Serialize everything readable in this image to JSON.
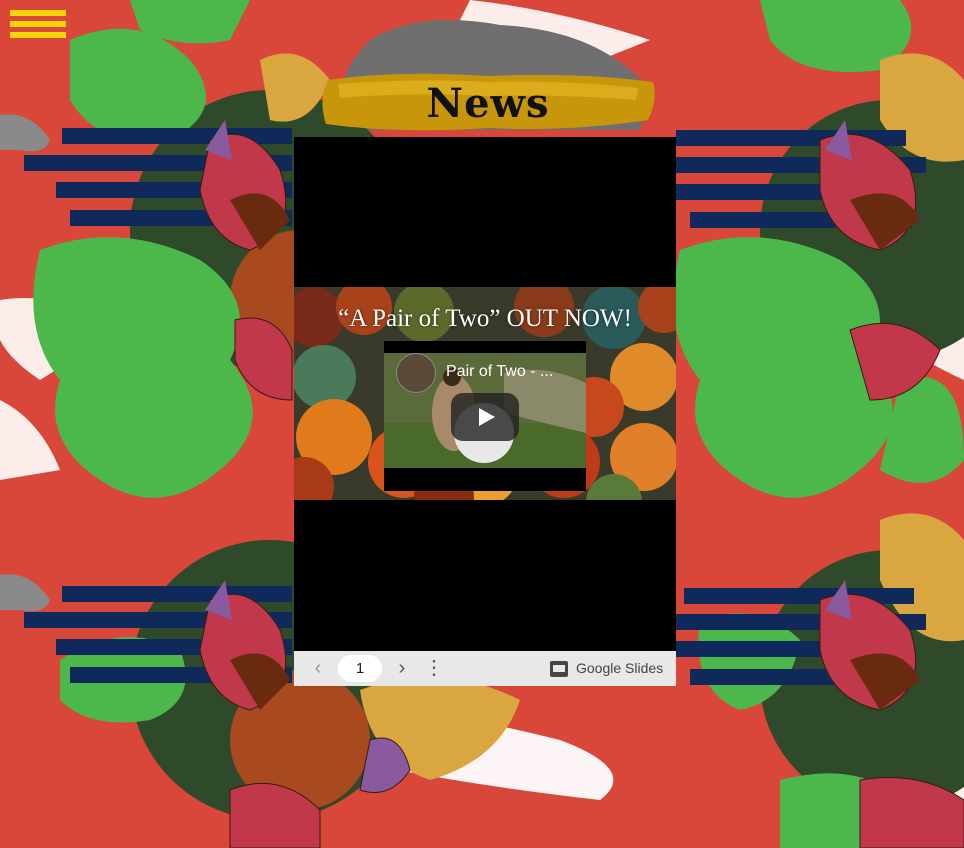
{
  "header": {
    "title": "News"
  },
  "slide": {
    "heading": "“A Pair of Two” OUT NOW!",
    "video_title": "Pair of Two - ..."
  },
  "toolbar": {
    "page_number": "1",
    "prev_icon": "‹",
    "next_icon": "›",
    "more_icon": "⋮",
    "brand_label": "Google Slides"
  },
  "colors": {
    "background": "#d9473a",
    "accent_yellow": "#f5d20a",
    "leaf_green": "#4cb84c",
    "navy": "#0f2a5a"
  }
}
